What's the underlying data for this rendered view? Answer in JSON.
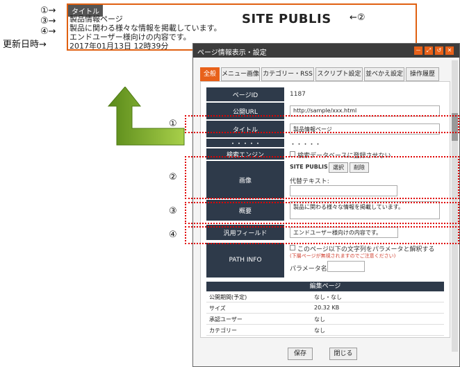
{
  "preview": {
    "title_tag": "タイトル",
    "line1": "製品情報ページ",
    "line2": "製品に関わる様々な情報を掲載しています。",
    "line3": "エンドユーザー様向けの内容です。",
    "line4": "2017年01月13日 12時39分",
    "logo": "SITE PUBLIS",
    "logo_anno": "←②"
  },
  "annotations": {
    "a1": "①→",
    "a3": "③→",
    "a4": "④→",
    "a_date": "更新日時→",
    "c1": "①",
    "c2": "②",
    "c3": "③",
    "c4": "④"
  },
  "dialog": {
    "title": "ページ情報表示・設定",
    "win_buttons": [
      "－",
      "⤢",
      "↺",
      "✕"
    ],
    "tabs": [
      "全般",
      "メニュー画像",
      "カテゴリー・RSS",
      "スクリプト設定",
      "並べかえ設定",
      "操作履歴"
    ],
    "fields": {
      "page_id_label": "ページID",
      "page_id_value": "1187",
      "url_label": "公開URL",
      "url_value": "http://sample/xxx.html",
      "title_label": "タイトル",
      "title_value": "製品情報ページ",
      "dots": "・・・・・",
      "dots_value": "・・・・・",
      "search_label": "検索エンジン",
      "search_check": "検索データベースに登録させない",
      "image_label": "画像",
      "image_logo": "SITE PUBLIS",
      "image_select": "選択",
      "image_delete": "削除",
      "alt_label": "代替テキスト:",
      "summary_label": "概要",
      "summary_value": "製品に関わる様々な情報を掲載しています。",
      "generic_label": "汎用フィールド",
      "generic_value": "エンドユーザー様向けの内容です。",
      "path_label": "PATH INFO",
      "path_check": "このページ以下の文字列をパラメータと解釈する",
      "path_note": "(下層ページが無視されますのでご注意ください)",
      "param_label": "パラメータ名"
    },
    "edit_table": {
      "header": "編集ページ",
      "rows": [
        [
          "公開期間(予定)",
          "なし・なし"
        ],
        [
          "サイズ",
          "20.32 KB"
        ],
        [
          "承認ユーザー",
          "なし"
        ],
        [
          "カテゴリー",
          "なし"
        ]
      ]
    },
    "save": "保存",
    "close": "閉じる"
  }
}
